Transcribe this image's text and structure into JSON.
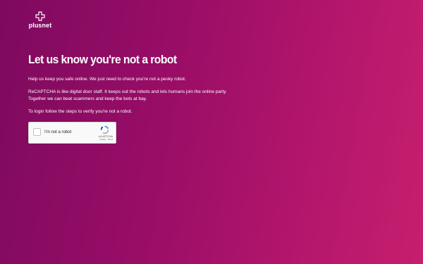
{
  "brand": {
    "name": "plusnet",
    "logo_icon": "plusnet-plus-icon"
  },
  "page": {
    "headline": "Let us know you're not a robot",
    "paragraphs": {
      "p1": "Help us keep you safe online. We just need to check you're not a pesky robot.",
      "p2_line1": "ReCAPTCHA is like digital door staff. It keeps out the robots and lets humans join the online party.",
      "p2_line2": "Together we can beat scammers and keep the bots at bay.",
      "p3": "To login follow the steps to verify you're not a robot."
    }
  },
  "captcha": {
    "checkbox_label": "I'm not a robot",
    "brand": "reCAPTCHA",
    "privacy_link": "Privacy",
    "separator": "-",
    "terms_link": "Terms",
    "checked": false
  },
  "colors": {
    "background_start": "#7d0a5e",
    "background_end": "#c71e6e",
    "text": "#ffffff"
  }
}
